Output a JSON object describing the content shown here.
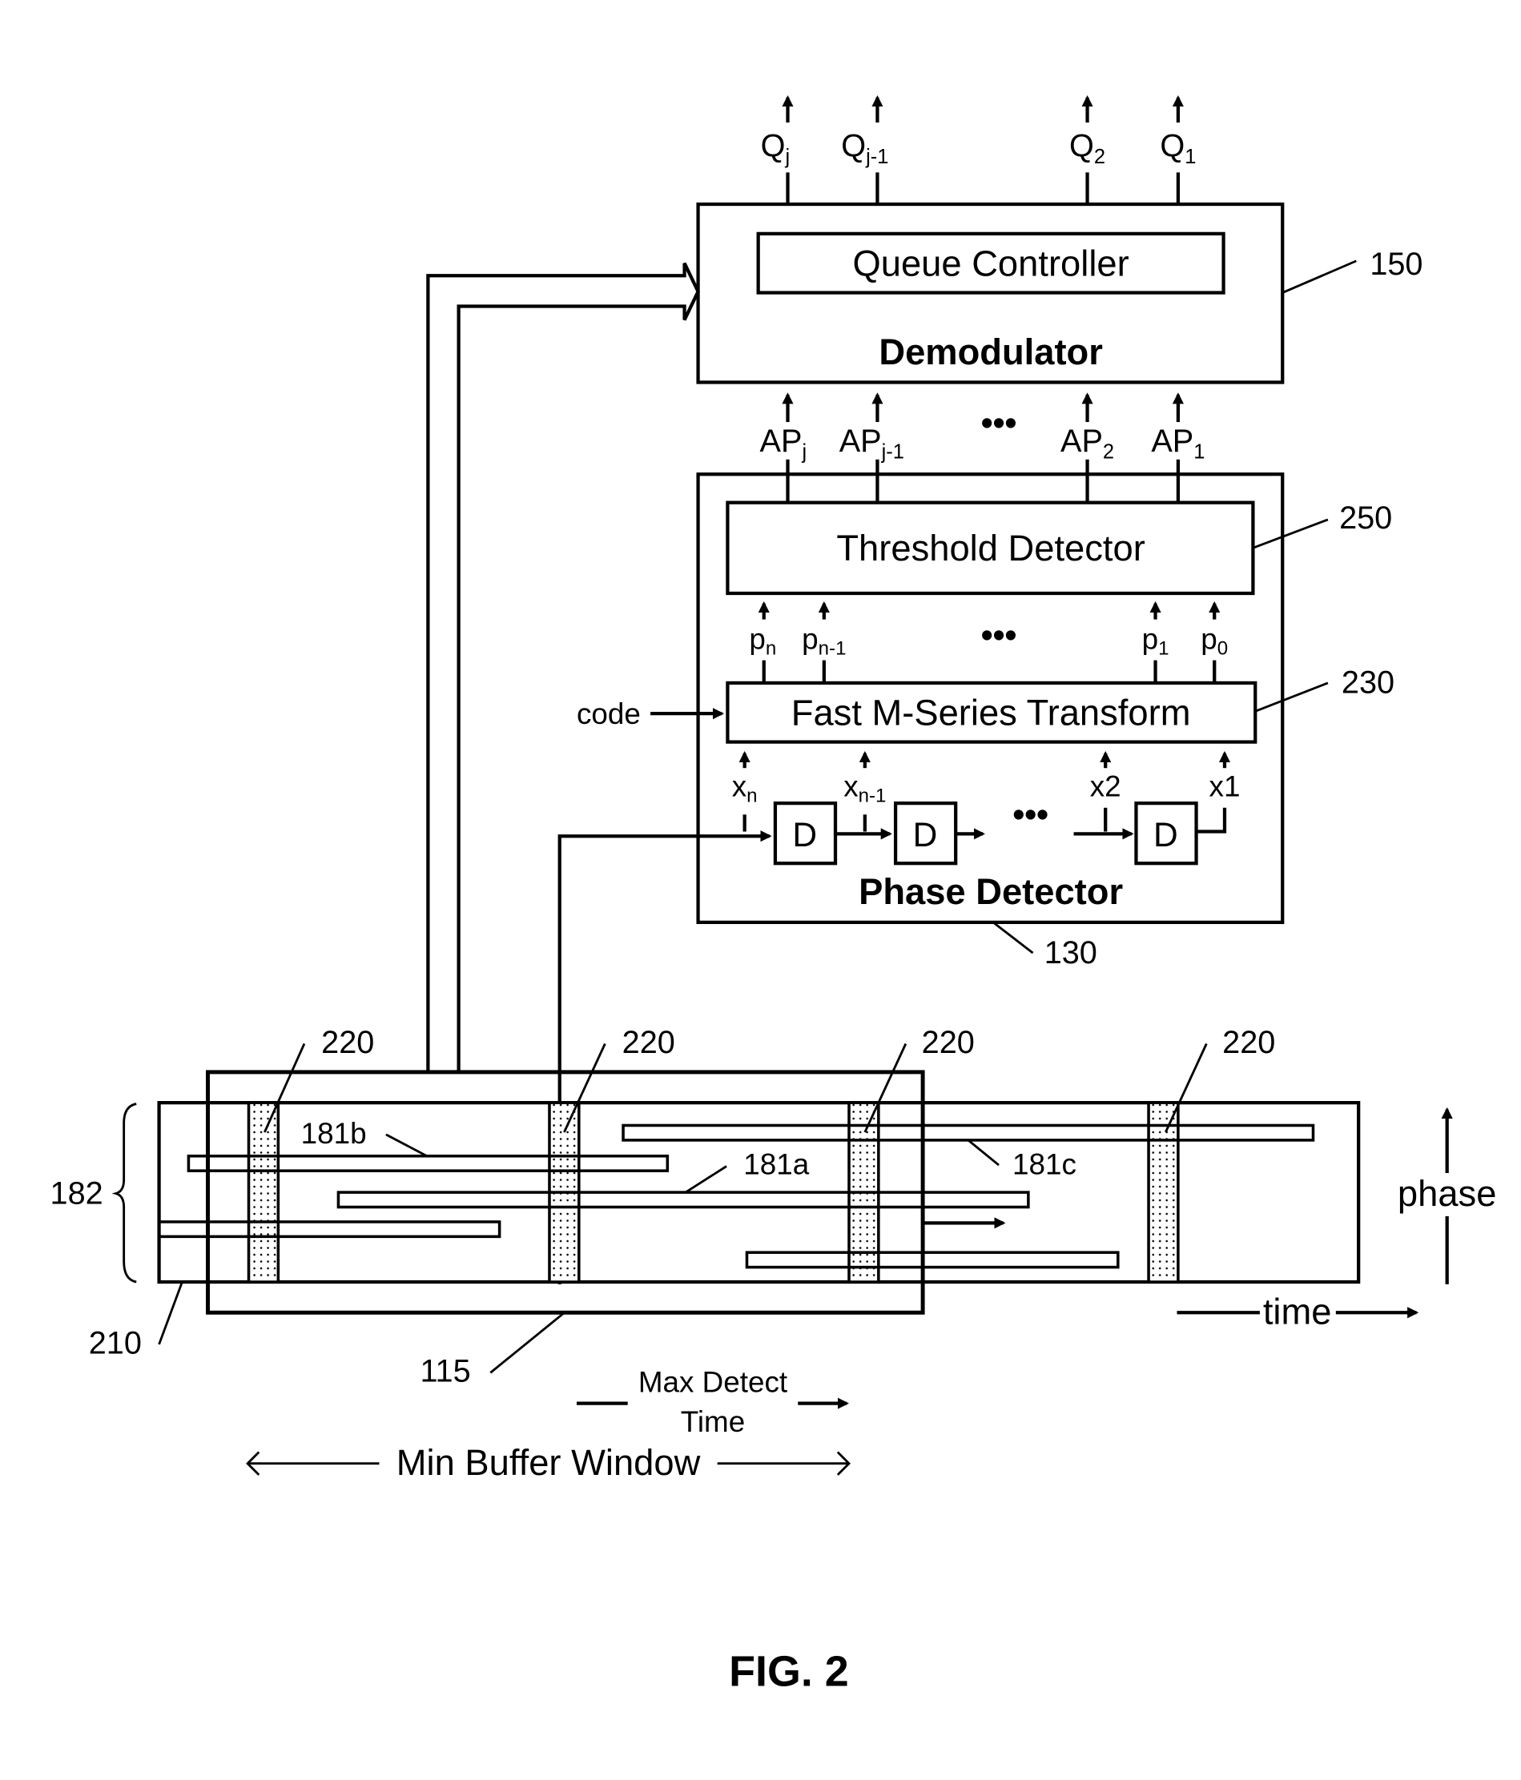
{
  "figure": {
    "caption": "FIG. 2",
    "demodulator": {
      "ref": "150",
      "title": "Demodulator",
      "inner_label": "Queue Controller",
      "outputs": [
        {
          "base": "Q",
          "sub": "j"
        },
        {
          "base": "Q",
          "sub": "j-1"
        },
        {
          "base": "Q",
          "sub": "2"
        },
        {
          "base": "Q",
          "sub": "1"
        }
      ],
      "inputs": [
        {
          "base": "AP",
          "sub": "j"
        },
        {
          "base": "AP",
          "sub": "j-1"
        },
        {
          "base": "AP",
          "sub": "2"
        },
        {
          "base": "AP",
          "sub": "1"
        }
      ],
      "ellipsis": "•••"
    },
    "phase_detector": {
      "ref": "130",
      "title": "Phase Detector",
      "threshold_detector": {
        "ref": "250",
        "label": "Threshold Detector"
      },
      "transform": {
        "ref": "230",
        "label": "Fast M-Series Transform",
        "code_input": "code"
      },
      "p_signals": [
        {
          "base": "p",
          "sub": "n"
        },
        {
          "base": "p",
          "sub": "n-1"
        },
        {
          "base": "p",
          "sub": "1"
        },
        {
          "base": "p",
          "sub": "0"
        }
      ],
      "x_signals": [
        {
          "base": "x",
          "sub": "n"
        },
        {
          "base": "x",
          "sub": "n-1"
        },
        {
          "base": "x2",
          "sub": ""
        },
        {
          "base": "x1",
          "sub": ""
        }
      ],
      "delay_label": "D",
      "ellipsis": "•••"
    },
    "buffer": {
      "window_ref": "115",
      "signal_ref": "210",
      "band_ref": "182",
      "slot_ref": "220",
      "signals": [
        "181a",
        "181b",
        "181c"
      ],
      "axis_phase": "phase",
      "axis_time": "time",
      "max_detect_line1": "Max Detect",
      "max_detect_line2": "Time",
      "min_buffer_window": "Min Buffer Window"
    }
  }
}
